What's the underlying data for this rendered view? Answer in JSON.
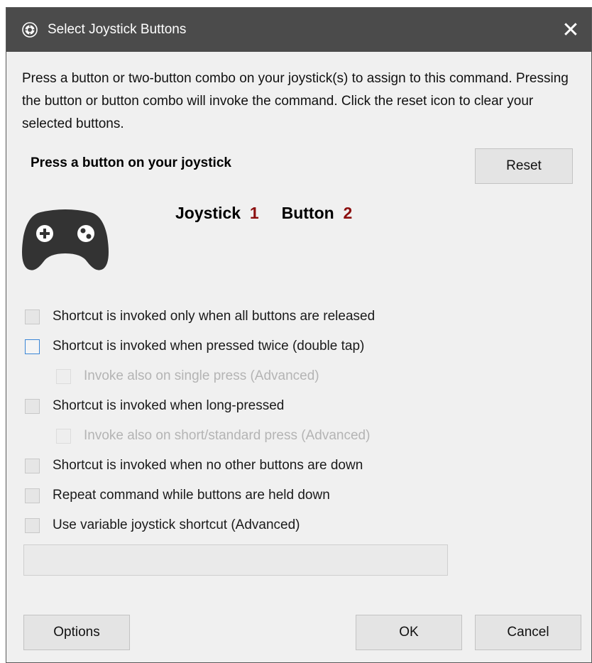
{
  "window": {
    "title": "Select Joystick Buttons",
    "close_glyph": "✕",
    "icon": "app-gear-icon"
  },
  "description": "Press a button or two-button combo on your joystick(s) to assign to this command.  Pressing the button or button combo will invoke the command.  Click the reset icon to clear your selected buttons.",
  "prompt": "Press a button on your joystick",
  "reset_label": "Reset",
  "gamepad_icon": "gamepad-icon",
  "readout": {
    "joystick_label": "Joystick",
    "joystick_value": "1",
    "button_label": "Button",
    "button_value": "2"
  },
  "options": [
    {
      "label": "Shortcut is invoked only when all buttons are released",
      "checked": false,
      "enabled": true
    },
    {
      "label": "Shortcut is invoked when pressed twice (double tap)",
      "checked": false,
      "enabled": true,
      "focused": true
    },
    {
      "label": "Invoke also on single press (Advanced)",
      "checked": false,
      "enabled": false
    },
    {
      "label": "Shortcut is invoked when long-pressed",
      "checked": false,
      "enabled": true
    },
    {
      "label": "Invoke also on short/standard press (Advanced)",
      "checked": false,
      "enabled": false
    },
    {
      "label": "Shortcut is invoked when no other buttons are down",
      "checked": false,
      "enabled": true
    },
    {
      "label": "Repeat command while buttons are held down",
      "checked": false,
      "enabled": true
    },
    {
      "label": "Use variable joystick shortcut (Advanced)",
      "checked": false,
      "enabled": true
    }
  ],
  "variable_field": {
    "value": ""
  },
  "footer": {
    "options_label": "Options",
    "ok_label": "OK",
    "cancel_label": "Cancel"
  },
  "colors": {
    "titlebar": "#4b4b4b",
    "readout_number": "#8b0f0f",
    "focus_border": "#3a86d6"
  }
}
